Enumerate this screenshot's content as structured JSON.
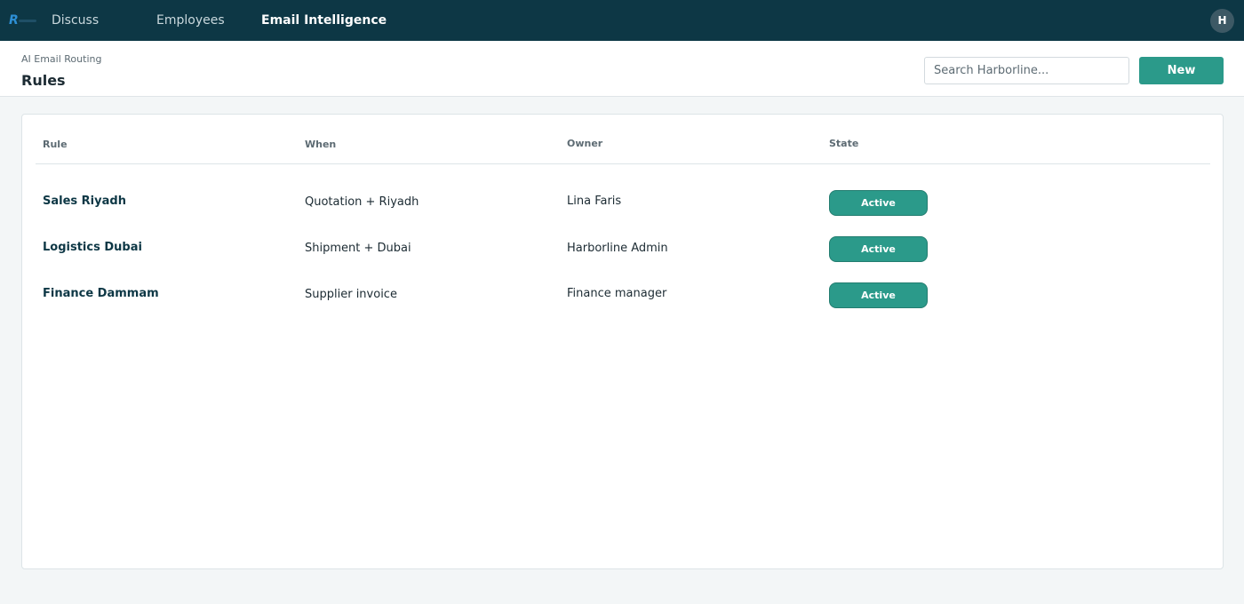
{
  "topbar": {
    "nav": [
      {
        "label": "Discuss",
        "active": false
      },
      {
        "label": "Employees",
        "active": false
      },
      {
        "label": "Email Intelligence",
        "active": true
      }
    ],
    "avatar_initial": "H"
  },
  "control_panel": {
    "breadcrumb": "AI Email Routing",
    "title": "Rules",
    "search_placeholder": "Search Harborline...",
    "new_label": "New"
  },
  "table": {
    "columns": [
      "Rule",
      "When",
      "Owner",
      "State"
    ],
    "rows": [
      {
        "rule": "Sales Riyadh",
        "when": "Quotation + Riyadh",
        "owner": "Lina Faris",
        "state": "Active"
      },
      {
        "rule": "Logistics Dubai",
        "when": "Shipment + Dubai",
        "owner": "Harborline Admin",
        "state": "Active"
      },
      {
        "rule": "Finance Dammam",
        "when": "Supplier invoice",
        "owner": "Finance manager",
        "state": "Active"
      }
    ]
  },
  "colors": {
    "topbar": "#0d3745",
    "accent": "#2b9a8a"
  }
}
